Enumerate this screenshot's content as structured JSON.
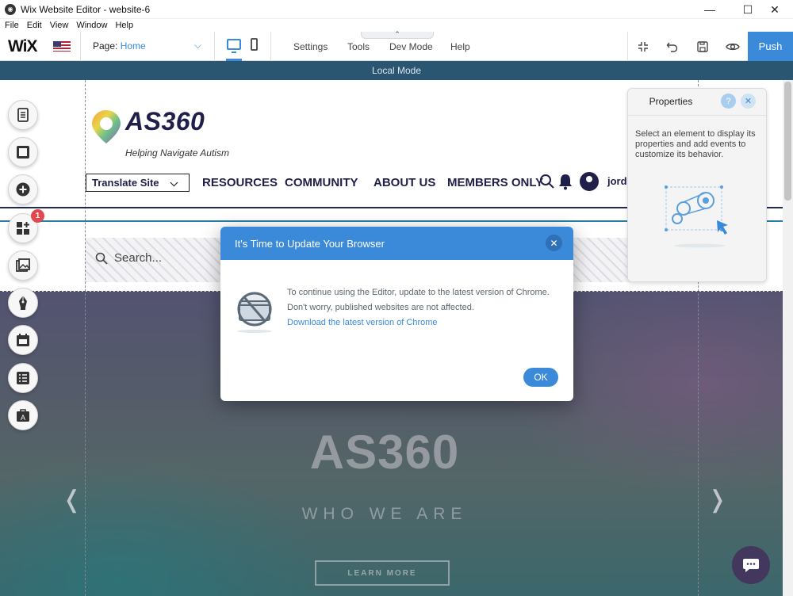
{
  "window": {
    "title": "Wix Website Editor - website-6",
    "minimize_glyph": "—",
    "maximize_glyph": "☐",
    "close_glyph": "✕"
  },
  "menubar": [
    "File",
    "Edit",
    "View",
    "Window",
    "Help"
  ],
  "topbar": {
    "logo": "WiX",
    "page_label": "Page:",
    "page_value": "Home",
    "menu": [
      "Settings",
      "Tools",
      "Dev Mode",
      "Help"
    ],
    "push_label": "Push",
    "accent": "#3b8ad9",
    "icons": [
      "desktop-icon",
      "mobile-icon",
      "zoom-out-icon",
      "undo-icon",
      "save-icon",
      "preview-eye-icon"
    ]
  },
  "localmode": {
    "label": "Local Mode",
    "color": "#2b5672"
  },
  "site": {
    "logo_text": "AS360",
    "tagline": "Helping Navigate Autism",
    "translate_label": "Translate Site",
    "nav": [
      "RESOURCES",
      "COMMUNITY",
      "ABOUT US",
      "MEMBERS ONLY"
    ],
    "user": "jord",
    "search_placeholder": "Search...",
    "hero_title": "AS360",
    "hero_subtitle": "WHO WE ARE",
    "hero_button": "LEARN MORE"
  },
  "lefttoolbar": {
    "badge": "1",
    "icons": [
      "pages-icon",
      "background-icon",
      "add-icon",
      "add-apps-icon",
      "media-icon",
      "blog-pen-icon",
      "bookings-icon",
      "cms-list-icon",
      "business-icon"
    ]
  },
  "properties": {
    "title": "Properties",
    "help_glyph": "?",
    "close_glyph": "✕",
    "text": "Select an element to display its properties and add events to customize its behavior."
  },
  "modal": {
    "title": "It's Time to Update Your Browser",
    "line1": "To continue using the Editor, update to the latest version of Chrome.",
    "line2": "Don't worry, published websites are not affected.",
    "link": "Download the latest version of Chrome",
    "ok": "OK",
    "close_glyph": "✕"
  }
}
